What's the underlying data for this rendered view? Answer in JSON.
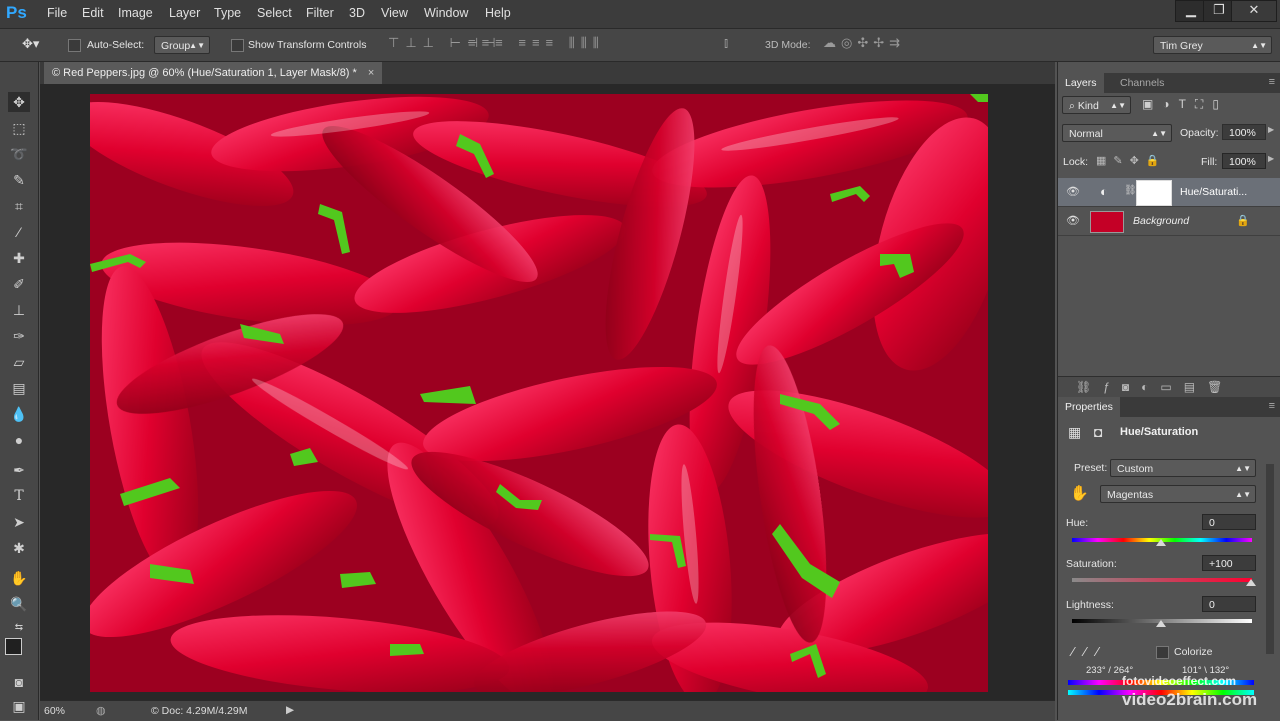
{
  "app": {
    "logo": "Ps",
    "minimize": "▁",
    "restore": "❐",
    "close": "✕"
  },
  "menu": [
    "File",
    "Edit",
    "Image",
    "Layer",
    "Type",
    "Select",
    "Filter",
    "3D",
    "View",
    "Window",
    "Help"
  ],
  "options": {
    "auto_select_label": "Auto-Select:",
    "auto_select_value": "Group",
    "show_transform_label": "Show Transform Controls",
    "mode_3d_label": "3D Mode:",
    "workspace": "Tim Grey"
  },
  "document": {
    "tab_title": "© Red Peppers.jpg @ 60% (Hue/Saturation 1, Layer Mask/8) *",
    "tab_close": "×",
    "zoom": "60%",
    "doc_size": "© Doc: 4.29M/4.29M"
  },
  "layers_panel": {
    "tabs": [
      "Layers",
      "Channels"
    ],
    "kind_label": "Kind",
    "blend_mode": "Normal",
    "opacity_label": "Opacity:",
    "opacity_value": "100%",
    "lock_label": "Lock:",
    "fill_label": "Fill:",
    "fill_value": "100%",
    "layers": [
      {
        "name": "Hue/Saturati...",
        "selected": true
      },
      {
        "name": "Background",
        "selected": false
      }
    ]
  },
  "properties_panel": {
    "tab": "Properties",
    "title": "Hue/Saturation",
    "preset_label": "Preset:",
    "preset_value": "Custom",
    "channel_value": "Magentas",
    "hue_label": "Hue:",
    "hue_value": "0",
    "saturation_label": "Saturation:",
    "saturation_value": "+100",
    "lightness_label": "Lightness:",
    "lightness_value": "0",
    "colorize_label": "Colorize",
    "range_left": "233° / 264°",
    "range_right": "101° \\ 132°"
  },
  "watermark": {
    "line1": "fotovideoeffect.com",
    "line2": "video2brain.com"
  },
  "colors": {
    "accent": "#31a8ff",
    "panel_bg": "#535353",
    "pepper_red": "#d8002a"
  }
}
